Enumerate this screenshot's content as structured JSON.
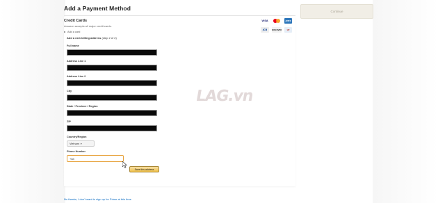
{
  "header": {
    "title": "Add a Payment Method",
    "continue_label": "Continue"
  },
  "credit_cards": {
    "title": "Credit Cards",
    "subtitle": "Amazon accepts all major credit cards.",
    "logos": [
      {
        "name": "visa",
        "label": "VISA"
      },
      {
        "name": "mastercard",
        "label": ""
      },
      {
        "name": "amex",
        "label": "AMEX"
      },
      {
        "name": "jcb",
        "label": "JCB"
      },
      {
        "name": "discover",
        "label": "DISCOVER"
      },
      {
        "name": "unionpay",
        "label": "UP"
      }
    ]
  },
  "form": {
    "add_card_link": "Add a card",
    "billing_heading": "Add a new billing address",
    "billing_step": "(step 2 of 2)",
    "fields": [
      {
        "label": "Full name",
        "value": ""
      },
      {
        "label": "Address Line 1",
        "value": ""
      },
      {
        "label": "Address Line 2",
        "value": ""
      },
      {
        "label": "City",
        "value": ""
      },
      {
        "label": "State / Province / Region",
        "value": ""
      },
      {
        "label": "ZIP",
        "value": ""
      }
    ],
    "country_label": "Country/Region",
    "country_value": "Vietnam",
    "phone_label": "Phone Number",
    "phone_value": "+84",
    "save_button": "Save this address"
  },
  "footer": {
    "no_thanks_link": "No thanks, I don't want to sign up for Prime at this time"
  },
  "watermark": "LAG.vn",
  "colors": {
    "link": "#0066c0",
    "focus": "#e7a23b",
    "button": "#f0c14b"
  }
}
